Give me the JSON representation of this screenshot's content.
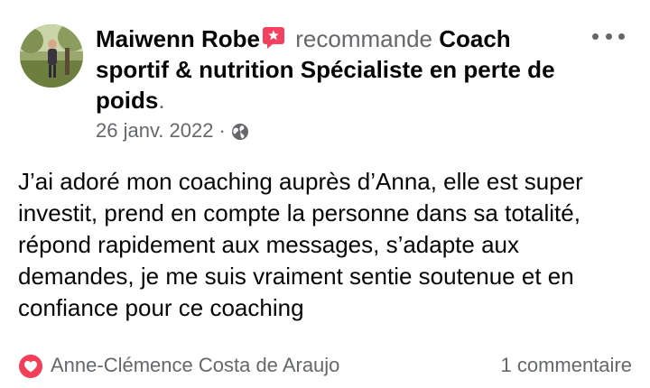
{
  "post": {
    "author": "Maiwenn Robe",
    "recommends_word": "recommande",
    "page_name": "Coach sportif & nutrition Spécialiste en perte de poids",
    "period": ".",
    "date": "26 janv. 2022",
    "separator": "·",
    "body": "J’ai adoré mon coaching auprès d’Anna, elle est super investit, prend en compte la personne dans sa totalité, répond rapidement aux messages, s’adapte aux demandes, je me suis vraiment sentie soutenue et en confiance pour ce coaching",
    "reactor": "Anne-Clémence Costa de Araujo",
    "comments": "1 commentaire",
    "icons": {
      "recommend": "recommend-flag-icon",
      "privacy": "globe-icon",
      "reaction": "love-reaction-icon",
      "more": "more-options-icon"
    },
    "colors": {
      "recommend": "#f3425f",
      "love": "#f33e58",
      "secondary_text": "#65676b",
      "primary_text": "#050505"
    }
  }
}
